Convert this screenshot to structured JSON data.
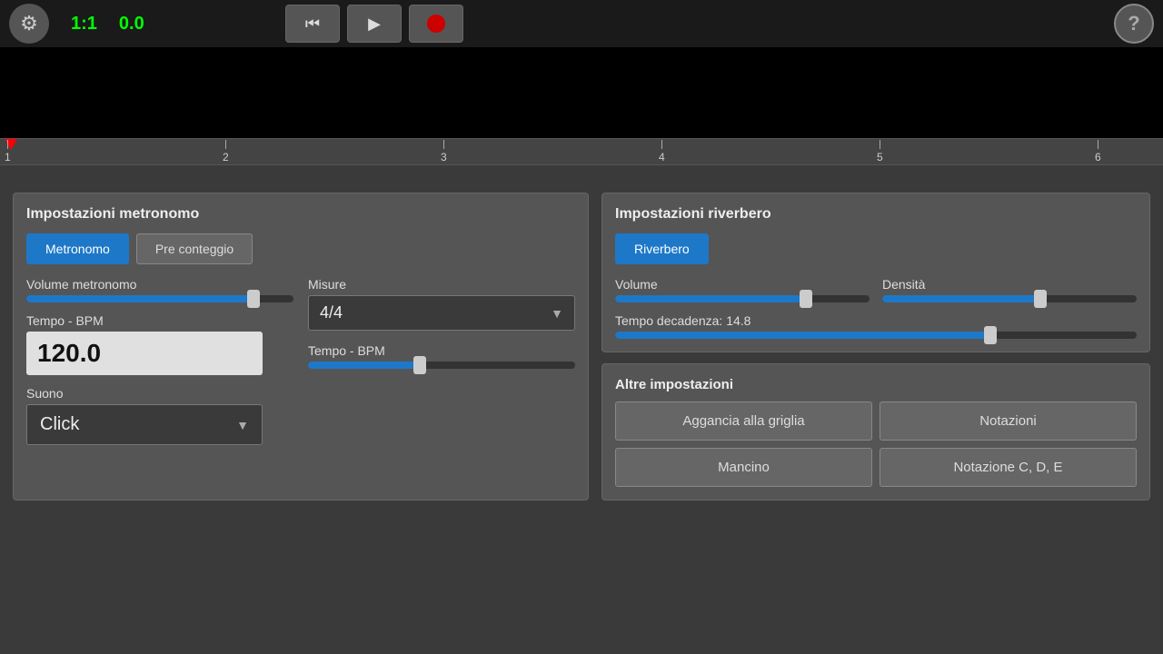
{
  "topbar": {
    "gear_icon": "⚙",
    "position_bar": "1:1",
    "position_time": "0.0",
    "rewind_icon": "⏮",
    "play_icon": "▶",
    "help_icon": "?"
  },
  "timeline": {
    "marks": [
      "1",
      "2",
      "3",
      "4",
      "5",
      "6"
    ]
  },
  "metronome_panel": {
    "title": "Impostazioni metronomo",
    "tab_metronome": "Metronomo",
    "tab_precount": "Pre conteggio",
    "volume_label": "Volume metronomo",
    "volume_percent": 85,
    "measures_label": "Misure",
    "measures_value": "4/4",
    "tempo_bpm_label_left": "Tempo - BPM",
    "tempo_bpm_value": "120.0",
    "tempo_bpm_label_right": "Tempo - BPM",
    "tempo_bpm_slider_percent": 42,
    "sound_label": "Suono",
    "sound_value": "Click"
  },
  "reverb_panel": {
    "title": "Impostazioni riverbero",
    "tab_reverb": "Riverbero",
    "volume_label": "Volume",
    "volume_percent": 75,
    "density_label": "Densità",
    "density_percent": 62,
    "decay_label": "Tempo decadenza: 14.8",
    "decay_percent": 72
  },
  "other_panel": {
    "title": "Altre impostazioni",
    "btn_snap": "Aggancia alla griglia",
    "btn_notations": "Notazioni",
    "btn_lefthanded": "Mancino",
    "btn_notation_cde": "Notazione C, D, E"
  }
}
